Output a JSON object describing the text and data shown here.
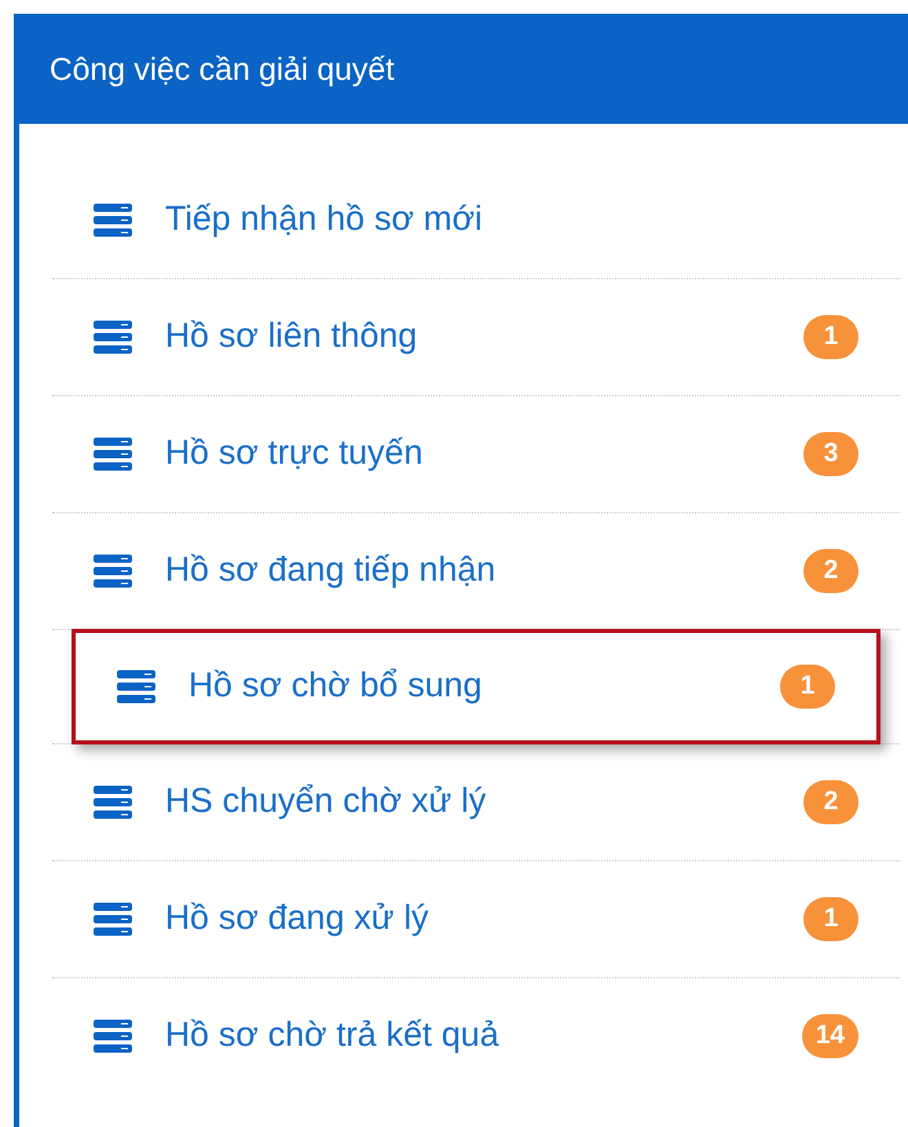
{
  "panel": {
    "title": "Công việc cần giải quyết"
  },
  "items": [
    {
      "label": "Tiếp nhận hồ sơ mới",
      "highlighted": false
    },
    {
      "label": "Hồ sơ liên thông",
      "badge": "1",
      "highlighted": false
    },
    {
      "label": "Hồ sơ trực tuyến",
      "badge": "3",
      "highlighted": false
    },
    {
      "label": "Hồ sơ đang tiếp nhận",
      "badge": "2",
      "highlighted": false
    },
    {
      "label": "Hồ sơ chờ bổ sung",
      "badge": "1",
      "highlighted": true
    },
    {
      "label": "HS chuyển chờ xử lý",
      "badge": "2",
      "highlighted": false
    },
    {
      "label": "Hồ sơ đang xử lý",
      "badge": "1",
      "highlighted": false
    },
    {
      "label": "Hồ sơ chờ trả kết quả",
      "badge": "14",
      "highlighted": false
    }
  ]
}
